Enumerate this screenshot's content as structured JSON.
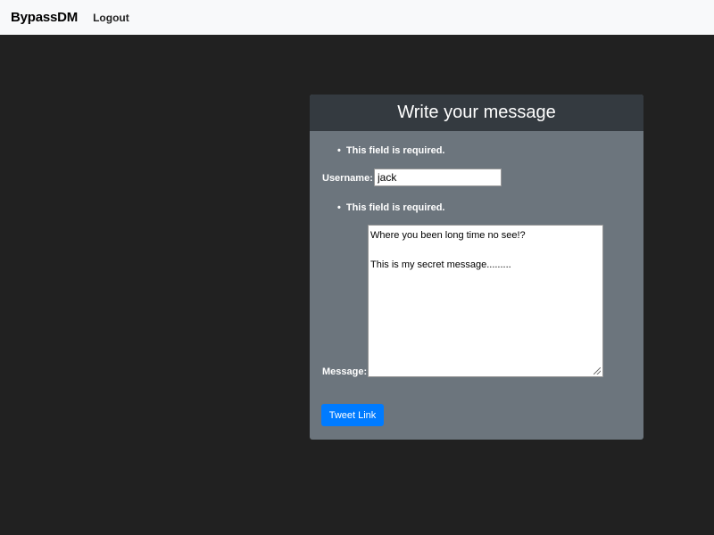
{
  "navbar": {
    "brand": "BypassDM",
    "logout_label": "Logout"
  },
  "form": {
    "title": "Write your message",
    "username_error": "This field is required.",
    "username_label": "Username:",
    "username_value": "jack",
    "message_error": "This field is required.",
    "message_label": "Message:",
    "message_lines": [
      "Where you been long time no see!?",
      "",
      "This is my secret message........."
    ],
    "submit_label": "Tweet Link"
  },
  "colors": {
    "page_background": "#212121",
    "navbar_background": "#f8f9fa",
    "card_background": "#6c757d",
    "card_header_background": "#343a40",
    "button_primary": "#007bff"
  }
}
